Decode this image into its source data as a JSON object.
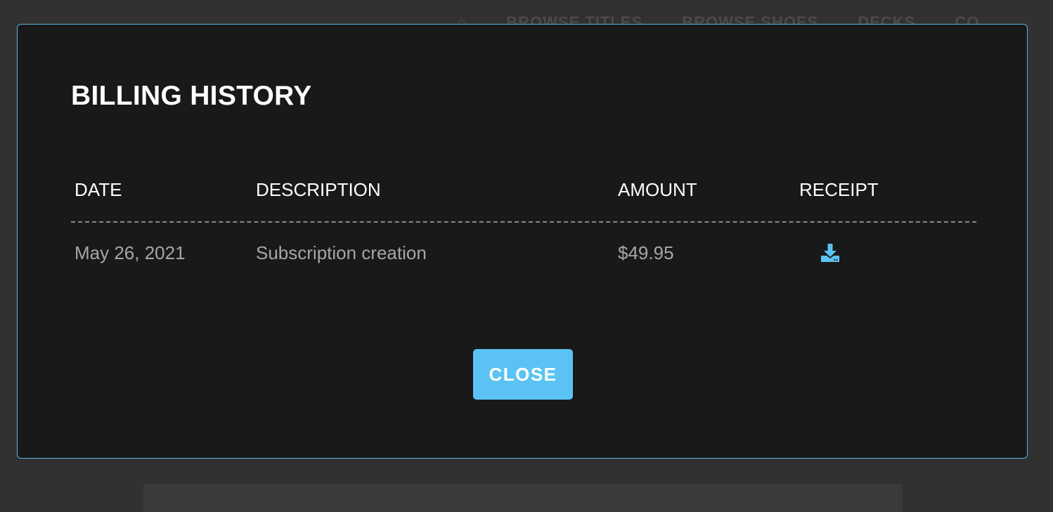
{
  "background": {
    "nav_items": [
      "BROWSE TITLES",
      "BROWSE SHOES",
      "DECKS",
      "CO"
    ]
  },
  "modal": {
    "title": "BILLING HISTORY",
    "columns": {
      "date": "DATE",
      "description": "DESCRIPTION",
      "amount": "AMOUNT",
      "receipt": "RECEIPT"
    },
    "rows": [
      {
        "date": "May 26, 2021",
        "description": "Subscription creation",
        "amount": "$49.95",
        "receipt_icon": "download-icon"
      }
    ],
    "close_label": "CLOSE"
  },
  "colors": {
    "accent": "#5bc3f3",
    "border": "#5ab2e0",
    "modal_bg": "#191919",
    "page_bg": "#313131"
  }
}
